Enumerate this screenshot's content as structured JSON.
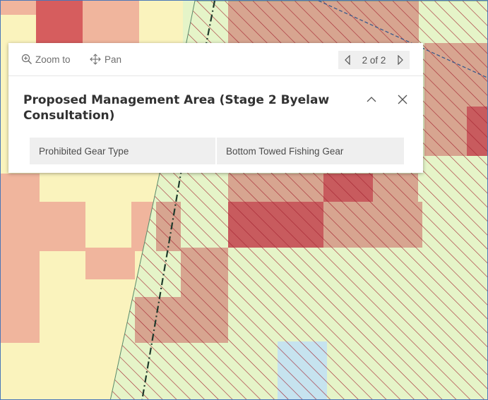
{
  "popup": {
    "actions": {
      "zoom_label": "Zoom to",
      "pan_label": "Pan"
    },
    "pager_text": "2 of 2",
    "title": "Proposed Management Area (Stage 2 Byelaw Consultation)",
    "attributes": [
      {
        "field": "Prohibited Gear Type",
        "value": "Bottom Towed Fishing Gear"
      }
    ]
  },
  "icons": {
    "zoom": "zoom-in-icon",
    "pan": "pan-move-icon",
    "prev": "caret-left-icon",
    "next": "caret-right-icon",
    "collapse": "chevron-up-icon",
    "close": "close-icon"
  },
  "colors": {
    "map_light_yellow": "#faf3bd",
    "map_salmon": "#f0b59d",
    "map_mid_red": "#d88b80",
    "map_dark_red": "#c85b5e",
    "map_light_green": "#e5f4c8",
    "map_light_blue": "#c6e3ef",
    "hatch_line": "#a3222f",
    "boundary_line": "#1f3a2c",
    "dashed_line": "#3a5a8c"
  }
}
